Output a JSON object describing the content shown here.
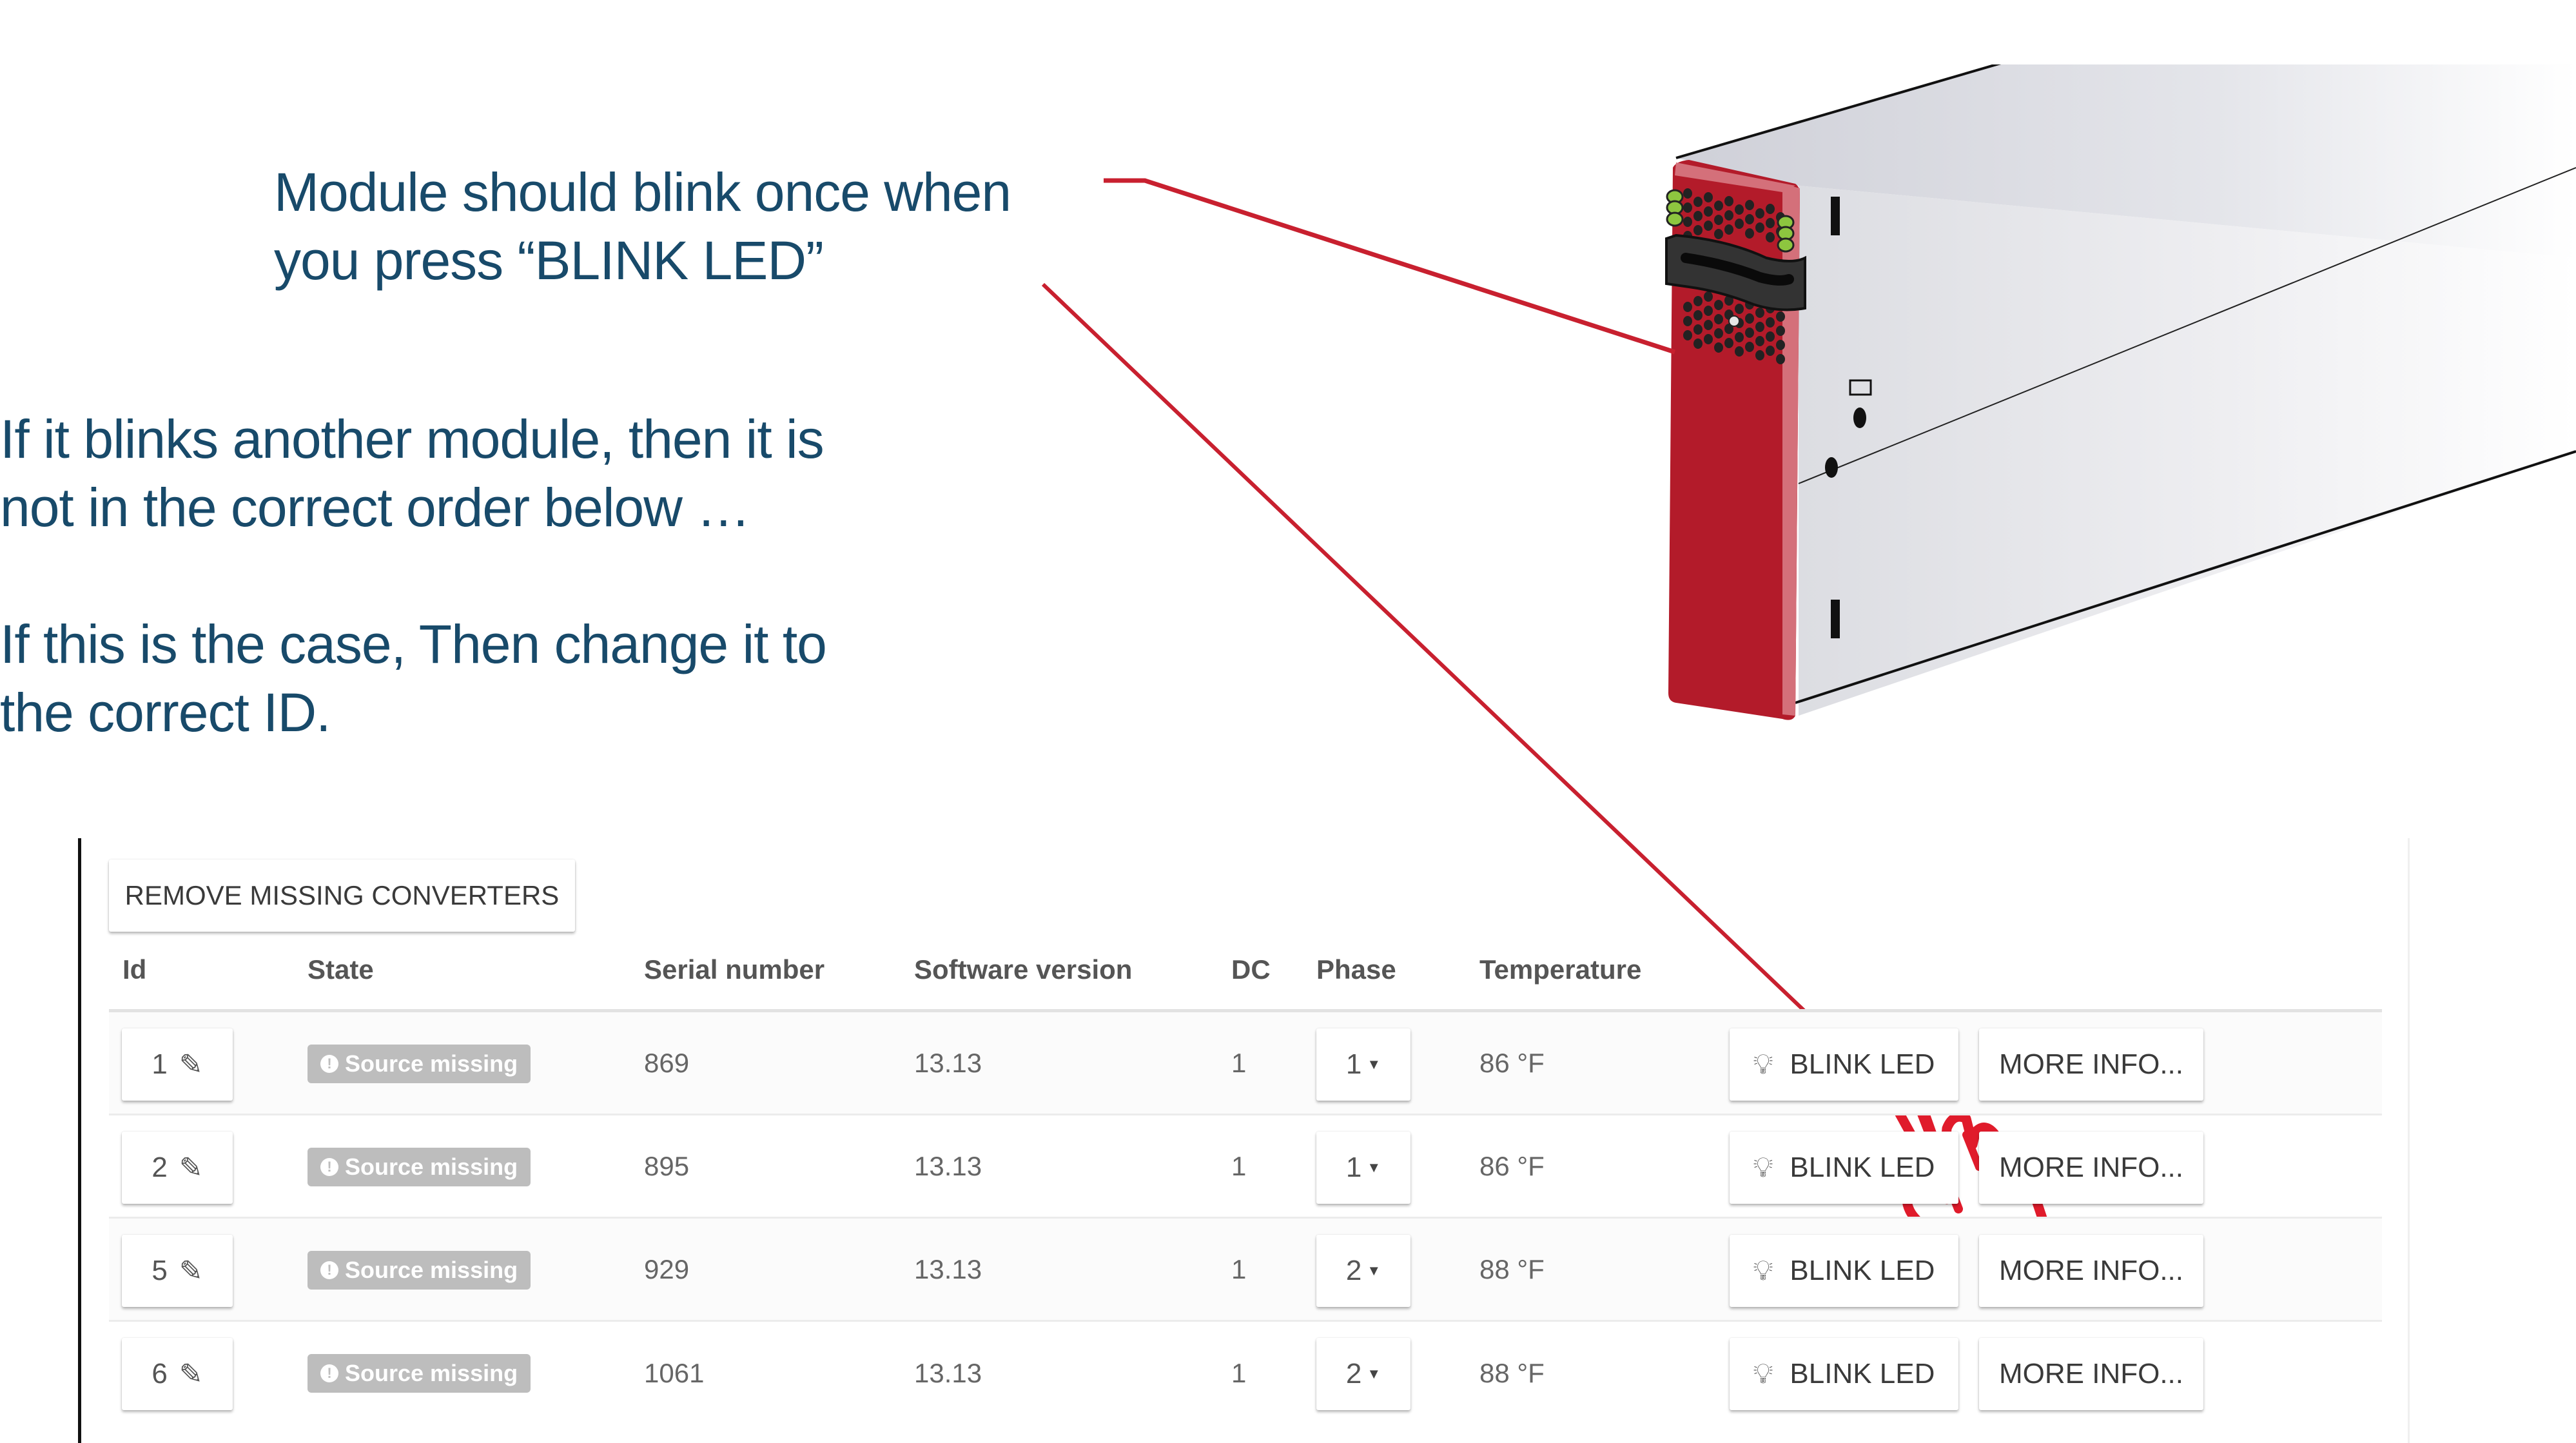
{
  "annotations": {
    "callout_1": [
      "Module should blink once when",
      "you press “BLINK LED”"
    ],
    "callout_2": [
      "If it blinks another module, then it is",
      "not in the correct order below …"
    ],
    "callout_3": [
      "If this is the case, Then change it to",
      "the correct ID."
    ],
    "text_color": "#184a6a",
    "line_color": "#c8202f"
  },
  "toolbar": {
    "remove_missing_label": "REMOVE MISSING CONVERTERS"
  },
  "table": {
    "headers": {
      "id": "Id",
      "state": "State",
      "serial": "Serial number",
      "software": "Software version",
      "dc": "DC",
      "phase": "Phase",
      "temperature": "Temperature"
    },
    "rows": [
      {
        "id": "1",
        "state": "Source missing",
        "serial": "869",
        "software": "13.13",
        "dc": "1",
        "phase": "1",
        "temperature": "86 °F",
        "blink_label": "BLINK LED",
        "more_label": "MORE INFO..."
      },
      {
        "id": "2",
        "state": "Source missing",
        "serial": "895",
        "software": "13.13",
        "dc": "1",
        "phase": "1",
        "temperature": "86 °F",
        "blink_label": "BLINK LED",
        "more_label": "MORE INFO..."
      },
      {
        "id": "5",
        "state": "Source missing",
        "serial": "929",
        "software": "13.13",
        "dc": "1",
        "phase": "2",
        "temperature": "88 °F",
        "blink_label": "BLINK LED",
        "more_label": "MORE INFO..."
      },
      {
        "id": "6",
        "state": "Source missing",
        "serial": "1061",
        "software": "13.13",
        "dc": "1",
        "phase": "2",
        "temperature": "88 °F",
        "blink_label": "BLINK LED",
        "more_label": "MORE INFO..."
      }
    ]
  },
  "icons": {
    "edit": "pencil-icon",
    "state": "exclamation-circle-icon",
    "blink": "lightbulb-icon",
    "phase": "caret-down-icon",
    "pointer": "hand-pointer-icon"
  },
  "colors": {
    "accent_red": "#b31b2a",
    "led_green": "#8dc63f",
    "badge_gray": "#bdbdbd"
  }
}
